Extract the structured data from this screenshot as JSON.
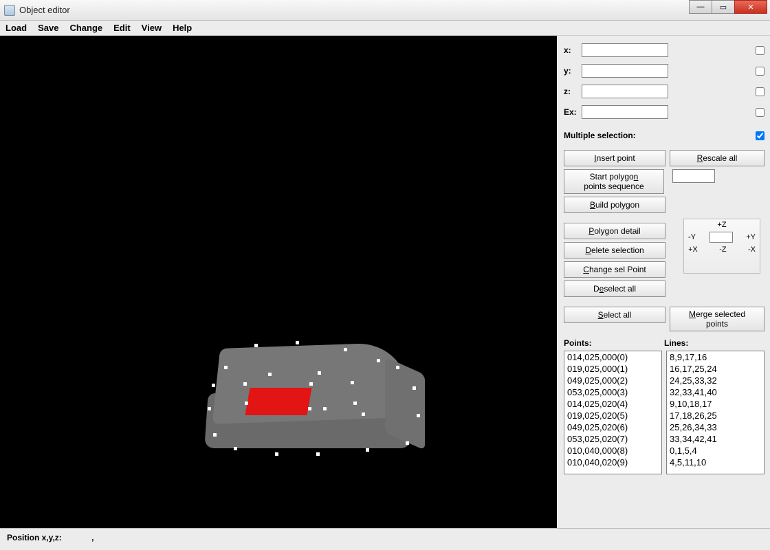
{
  "window": {
    "title": "Object editor"
  },
  "menu": {
    "load": "Load",
    "save": "Save",
    "change": "Change",
    "edit": "Edit",
    "view": "View",
    "help": "Help"
  },
  "coords": {
    "x_label": "x:",
    "y_label": "y:",
    "z_label": "z:",
    "ex_label": "Ex:",
    "x": "",
    "y": "",
    "z": "",
    "ex": "",
    "multiple_label": "Multiple selection:",
    "multiple_checked": true
  },
  "buttons": {
    "insert_point": "Insert point",
    "rescale_all": "Rescale all",
    "start_polygon": "Start polygon points sequence",
    "build_polygon": "Build polygon",
    "polygon_detail": "Polygon detail",
    "delete_selection": "Delete selection",
    "change_sel_point": "Change sel Point",
    "deselect_all": "Deselect all",
    "select_all": "Select all",
    "merge_selected": "Merge selected points"
  },
  "nudge": {
    "pz": "+Z",
    "mz": "-Z",
    "py": "+Y",
    "my": "-Y",
    "px": "+X",
    "mx": "-X",
    "val": ""
  },
  "lists": {
    "points_label": "Points:",
    "lines_label": "Lines:",
    "points": [
      "014,025,000(0)",
      "019,025,000(1)",
      "049,025,000(2)",
      "053,025,000(3)",
      "014,025,020(4)",
      "019,025,020(5)",
      "049,025,020(6)",
      "053,025,020(7)",
      "010,040,000(8)",
      "010,040,020(9)"
    ],
    "lines": [
      "8,9,17,16",
      "16,17,25,24",
      "24,25,33,32",
      "32,33,41,40",
      "9,10,18,17",
      "17,18,26,25",
      "25,26,34,33",
      "33,34,42,41",
      "0,1,5,4",
      "4,5,11,10"
    ]
  },
  "status": {
    "label": "Position x,y,z:",
    "value": ","
  }
}
